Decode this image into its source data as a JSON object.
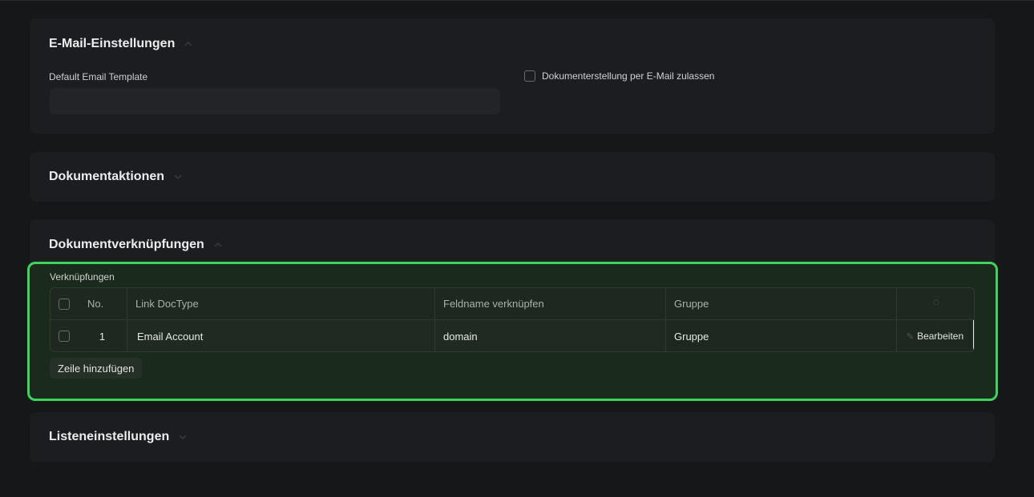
{
  "email_section": {
    "title": "E-Mail-Einstellungen",
    "default_template_label": "Default Email Template",
    "default_template_value": "",
    "allow_doc_creation_label": "Dokumenterstellung per E-Mail zulassen",
    "allow_doc_creation_checked": false
  },
  "actions_section": {
    "title": "Dokumentaktionen"
  },
  "links_section": {
    "title": "Dokumentverknüpfungen",
    "table_label": "Verknüpfungen",
    "columns": {
      "no": "No.",
      "link_doctype": "Link DocType",
      "link_fieldname": "Feldname verknüpfen",
      "group": "Gruppe"
    },
    "rows": [
      {
        "no": "1",
        "link_doctype": "Email Account",
        "link_fieldname": "domain",
        "group_placeholder": "Gruppe",
        "edit_label": "Bearbeiten"
      }
    ],
    "add_row_label": "Zeile hinzufügen"
  },
  "list_section": {
    "title": "Listeneinstellungen"
  },
  "colors": {
    "background": "#161719",
    "section_bg": "#1c1d20",
    "highlight_border": "#3ed35a",
    "highlight_bg": "#1a2b1e"
  },
  "icons": [
    "chevron-up-icon",
    "chevron-down-icon",
    "edit-icon",
    "settings-icon"
  ]
}
